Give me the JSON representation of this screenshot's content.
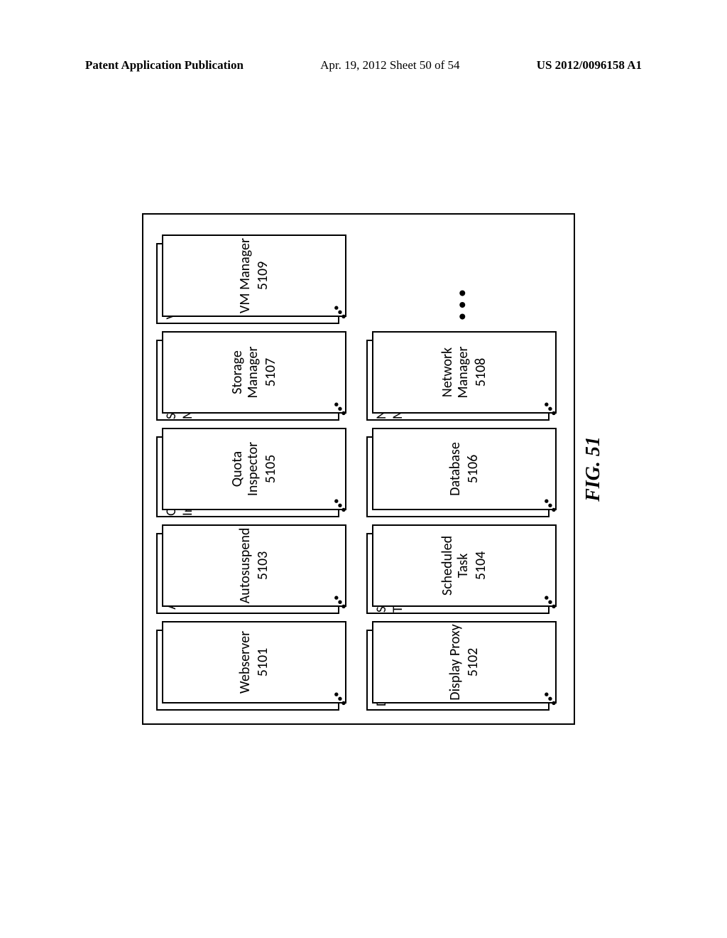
{
  "header": {
    "left": "Patent Application Publication",
    "center": "Apr. 19, 2012  Sheet 50 of 54",
    "right": "US 2012/0096158 A1"
  },
  "figure_label": "FIG. 51",
  "ellipsis": "•••",
  "small_dots": "•••",
  "row1": [
    {
      "back": "Webserver",
      "front": "Webserver",
      "ref": "5101"
    },
    {
      "back": "Autosuspend",
      "front": "Autosuspend",
      "ref": "5103"
    },
    {
      "back": "Quota Inspector",
      "front": "Quota Inspector",
      "ref": "5105"
    },
    {
      "back": "Storage Manager",
      "front": "Storage Manager",
      "ref": "5107"
    },
    {
      "back": "VM Manager",
      "front": "VM Manager",
      "ref": "5109"
    }
  ],
  "row2": [
    {
      "back": "Display Proxy",
      "front": "Display Proxy",
      "ref": "5102"
    },
    {
      "back": "Scheduled Task",
      "front": "Scheduled Task",
      "ref": "5104"
    },
    {
      "back": "Database",
      "front": "Database",
      "ref": "5106"
    },
    {
      "back": "Network Manager",
      "front": "Network Manager",
      "ref": "5108"
    }
  ]
}
